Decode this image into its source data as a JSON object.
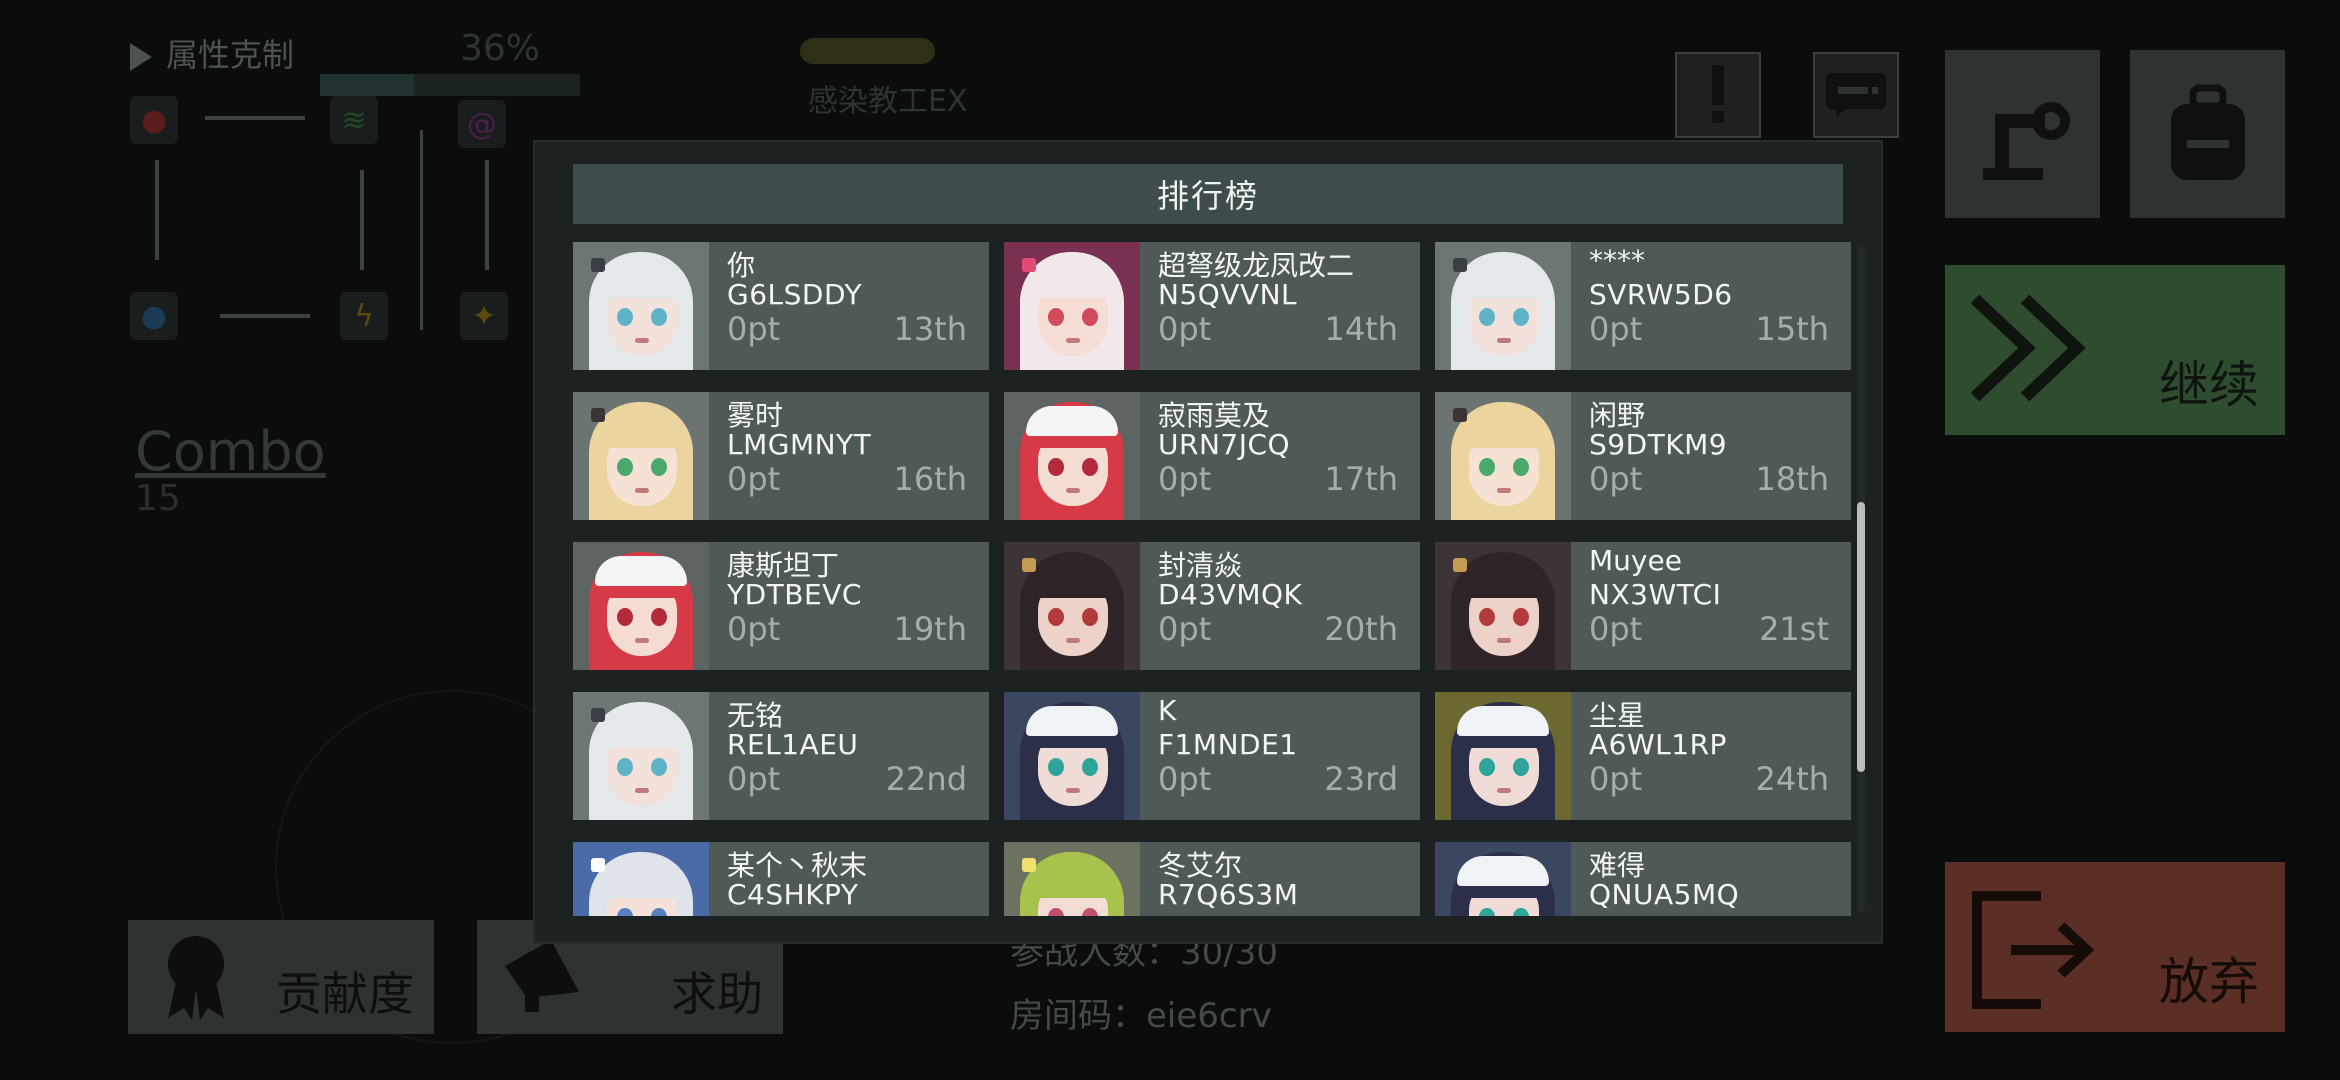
{
  "background": {
    "attribute_title": "属性克制",
    "progress_percent": "36%",
    "progress_fraction": 0.36,
    "stage_name": "感染教工EX",
    "combo_label": "Combo",
    "combo_count": "15",
    "participants": "参战人数：30/30",
    "room_code": "房间码：eie6crv"
  },
  "buttons": {
    "continue": "继续",
    "abandon": "放弃",
    "contribution": "贡献度",
    "help": "求助",
    "alert_icon": "exclamation-icon",
    "chat_icon": "chat-icon",
    "build_icon": "robot-arm-icon",
    "bag_icon": "backpack-icon"
  },
  "leaderboard": {
    "title": "排行榜",
    "entries": [
      {
        "name": "你",
        "code": "G6LSDDY",
        "score": "0pt",
        "rank": "13th",
        "avatar": "white-hair"
      },
      {
        "name": "超弩级龙凤改二",
        "code": "N5QVVNL",
        "score": "0pt",
        "rank": "14th",
        "avatar": "pink-hair"
      },
      {
        "name": "****",
        "code": "SVRW5D6",
        "score": "0pt",
        "rank": "15th",
        "avatar": "white-hair"
      },
      {
        "name": "雾时",
        "code": "LMGMNYT",
        "score": "0pt",
        "rank": "16th",
        "avatar": "blonde-hair"
      },
      {
        "name": "寂雨莫及",
        "code": "URN7JCQ",
        "score": "0pt",
        "rank": "17th",
        "avatar": "red-hair-cap"
      },
      {
        "name": "闲野",
        "code": "S9DTKM9",
        "score": "0pt",
        "rank": "18th",
        "avatar": "blonde-hair"
      },
      {
        "name": "康斯坦丁",
        "code": "YDTBEVC",
        "score": "0pt",
        "rank": "19th",
        "avatar": "red-hair-cap"
      },
      {
        "name": "封清焱",
        "code": "D43VMQK",
        "score": "0pt",
        "rank": "20th",
        "avatar": "dark-hair"
      },
      {
        "name": "Muyee",
        "code": "NX3WTCI",
        "score": "0pt",
        "rank": "21st",
        "avatar": "dark-hair"
      },
      {
        "name": "无铭",
        "code": "REL1AEU",
        "score": "0pt",
        "rank": "22nd",
        "avatar": "white-hair"
      },
      {
        "name": "K",
        "code": "F1MNDE1",
        "score": "0pt",
        "rank": "23rd",
        "avatar": "navy-hair-cap"
      },
      {
        "name": "尘星",
        "code": "A6WL1RP",
        "score": "0pt",
        "rank": "24th",
        "avatar": "navy-hair-cap-glow"
      },
      {
        "name": "某个丶秋末",
        "code": "C4SHKPY",
        "score": "",
        "rank": "",
        "avatar": "silver-hair"
      },
      {
        "name": "冬艾尔",
        "code": "R7Q6S3M",
        "score": "",
        "rank": "",
        "avatar": "green-hair"
      },
      {
        "name": "难得",
        "code": "QNUA5MQ",
        "score": "",
        "rank": "",
        "avatar": "navy-hair-cap"
      }
    ]
  },
  "colors": {
    "continue_bg": "#2d4d2e",
    "abandon_bg": "#5b2f25",
    "card_bg": "#4f5a58",
    "header_bg": "#3f4c4c"
  }
}
